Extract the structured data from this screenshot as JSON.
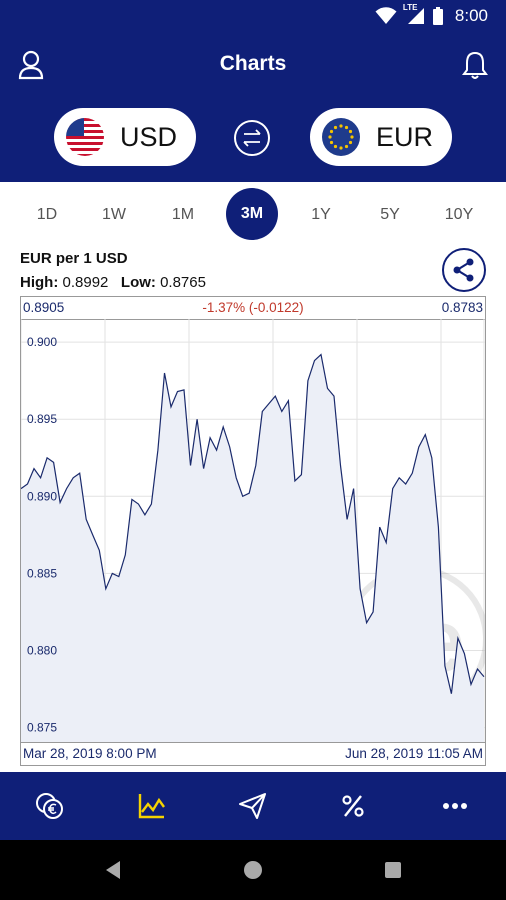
{
  "status": {
    "time": "8:00",
    "network": "LTE"
  },
  "appbar": {
    "title": "Charts"
  },
  "currency": {
    "from": "USD",
    "to": "EUR"
  },
  "tabs": [
    {
      "label": "1D",
      "active": false
    },
    {
      "label": "1W",
      "active": false
    },
    {
      "label": "1M",
      "active": false
    },
    {
      "label": "3M",
      "active": true
    },
    {
      "label": "1Y",
      "active": false
    },
    {
      "label": "5Y",
      "active": false
    },
    {
      "label": "10Y",
      "active": false
    }
  ],
  "pair": {
    "label": "EUR per 1 USD"
  },
  "stats": {
    "high_label": "High:",
    "high": "0.8992",
    "low_label": "Low:",
    "low": "0.8765"
  },
  "chart_header": {
    "start": "0.8905",
    "change": "-1.37% (-0.0122)",
    "end": "0.8783"
  },
  "chart_footer": {
    "start_date": "Mar 28, 2019 8:00 PM",
    "end_date": "Jun 28, 2019 11:05 AM"
  },
  "watermark": "xe",
  "colors": {
    "brand": "#0f1f78",
    "line": "#1a2a6c",
    "fill": "#eceff7",
    "negative": "#c0392b"
  },
  "chart_data": {
    "type": "area",
    "title": "EUR per 1 USD",
    "ylim": [
      0.874,
      0.9015
    ],
    "yticks": [
      "0.900",
      "0.895",
      "0.890",
      "0.885",
      "0.880",
      "0.875"
    ],
    "x": [
      "Mar 28, 2019 8:00 PM",
      "Jun 28, 2019 11:05 AM"
    ],
    "values": [
      0.8905,
      0.8908,
      0.8918,
      0.8912,
      0.8925,
      0.8922,
      0.8896,
      0.8905,
      0.8912,
      0.8915,
      0.8885,
      0.8875,
      0.8865,
      0.884,
      0.885,
      0.8848,
      0.8862,
      0.8898,
      0.8895,
      0.8888,
      0.8895,
      0.893,
      0.898,
      0.8958,
      0.8968,
      0.8969,
      0.892,
      0.895,
      0.8918,
      0.8938,
      0.893,
      0.8945,
      0.8932,
      0.8912,
      0.89,
      0.8902,
      0.892,
      0.8955,
      0.896,
      0.8965,
      0.8955,
      0.8962,
      0.891,
      0.8914,
      0.8975,
      0.8988,
      0.8992,
      0.897,
      0.8965,
      0.892,
      0.8885,
      0.8905,
      0.884,
      0.8818,
      0.8825,
      0.888,
      0.887,
      0.8905,
      0.8912,
      0.8908,
      0.8915,
      0.8932,
      0.894,
      0.8925,
      0.888,
      0.879,
      0.8772,
      0.8808,
      0.8798,
      0.8778,
      0.8788,
      0.8783
    ]
  },
  "bottom_nav": [
    {
      "name": "coins-nav",
      "active": false
    },
    {
      "name": "charts-nav",
      "active": true
    },
    {
      "name": "send-nav",
      "active": false
    },
    {
      "name": "rates-nav",
      "active": false
    },
    {
      "name": "more-nav",
      "active": false
    }
  ]
}
